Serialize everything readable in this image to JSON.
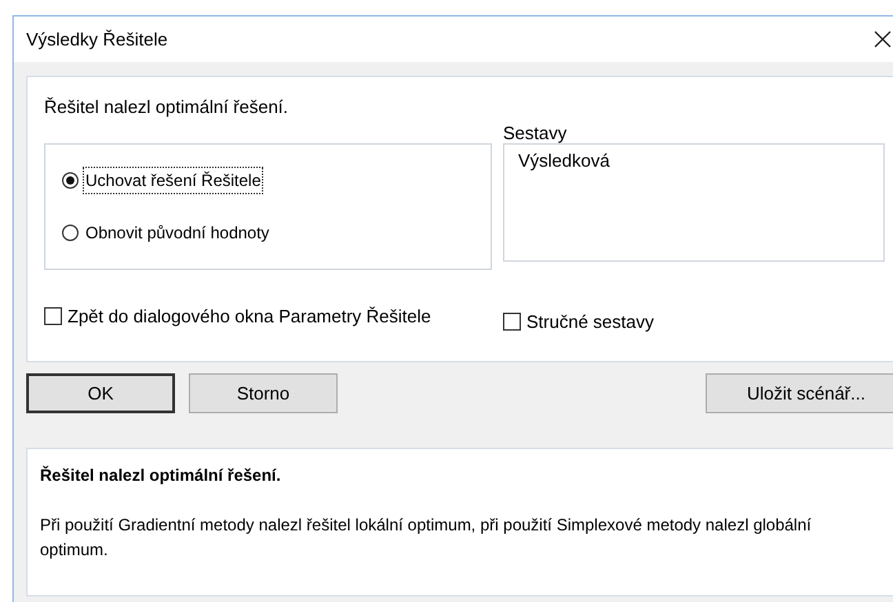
{
  "window": {
    "title": "Výsledky Řešitele"
  },
  "status": "Řešitel nalezl optimální řešení.",
  "options": [
    {
      "label": "Uchovat řešení Řešitele",
      "selected": true
    },
    {
      "label": "Obnovit původní hodnoty",
      "selected": false
    }
  ],
  "reports": {
    "label": "Sestavy",
    "items": [
      {
        "label": "Výsledková",
        "selected": false
      }
    ]
  },
  "return_checkbox": {
    "label": "Zpět do dialogového okna Parametry Řešitele",
    "checked": false
  },
  "outline_checkbox": {
    "label": "Stručné sestavy",
    "checked": false
  },
  "buttons": [
    {
      "label": "OK",
      "default": true
    },
    {
      "label": "Storno",
      "default": false
    },
    {
      "label": "Uložit scénář...",
      "default": false
    }
  ],
  "message": {
    "title": "Řešitel nalezl optimální řešení.",
    "text": "Při použití Gradientní metody nalezl řešitel lokální optimum, při použití Simplexové metody nalezl globální optimum."
  }
}
